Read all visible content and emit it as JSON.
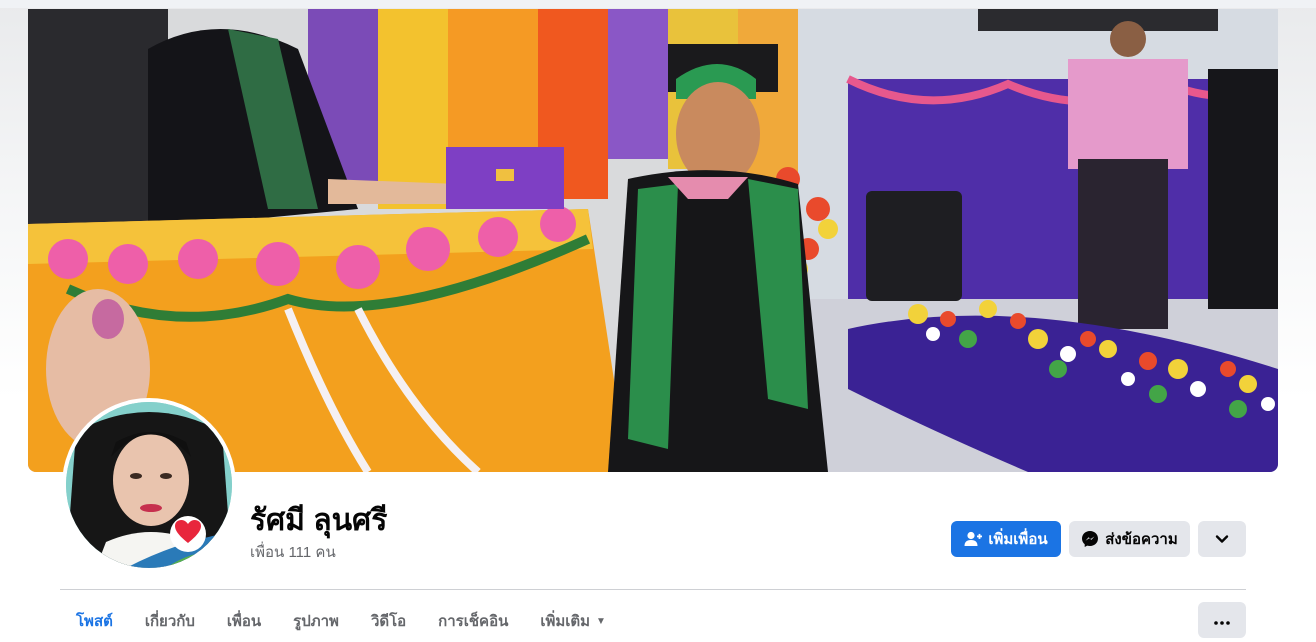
{
  "profile": {
    "name": "รัศมี ลุนศรี",
    "friends_text": "เพื่อน 111 คน"
  },
  "actions": {
    "add_friend_label": "เพิ่มเพื่อน",
    "message_label": "ส่งข้อความ"
  },
  "tabs": [
    {
      "label": "โพสต์",
      "active": true
    },
    {
      "label": "เกี่ยวกับ",
      "active": false
    },
    {
      "label": "เพื่อน",
      "active": false
    },
    {
      "label": "รูปภาพ",
      "active": false
    },
    {
      "label": "วิดีโอ",
      "active": false
    },
    {
      "label": "การเช็คอิน",
      "active": false
    },
    {
      "label": "เพิ่มเติม",
      "active": false
    }
  ],
  "colors": {
    "accent": "#1b74e4",
    "secondary_button": "#e4e6eb",
    "muted_text": "#65676b"
  },
  "icons": {
    "add_friend": "person-plus-icon",
    "message": "messenger-icon",
    "more": "chevron-down-icon",
    "tab_more": "caret-down-icon",
    "options": "three-dots-icon",
    "badge": "heart-icon"
  }
}
